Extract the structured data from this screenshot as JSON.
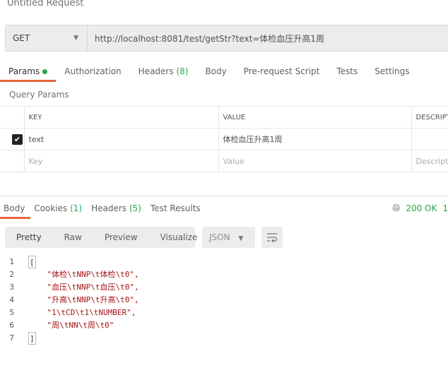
{
  "title": "Untitled Request",
  "request": {
    "method": "GET",
    "url": "http://localhost:8081/test/getStr?text=体检血压升高1周"
  },
  "tabs": [
    {
      "label": "Params"
    },
    {
      "label": "Authorization"
    },
    {
      "label": "Headers",
      "count": "(8)"
    },
    {
      "label": "Body"
    },
    {
      "label": "Pre-request Script"
    },
    {
      "label": "Tests"
    },
    {
      "label": "Settings"
    }
  ],
  "query_params_label": "Query Params",
  "params_table": {
    "headers": [
      "KEY",
      "VALUE",
      "DESCRIPT"
    ],
    "rows": [
      {
        "checked": true,
        "key": "text",
        "value": "体检血压升高1周"
      }
    ],
    "placeholder": {
      "key": "Key",
      "value": "Value",
      "desc": "Descript"
    }
  },
  "response": {
    "tabs": [
      {
        "label": "Body"
      },
      {
        "label": "Cookies",
        "count": "(1)"
      },
      {
        "label": "Headers",
        "count": "(5)"
      },
      {
        "label": "Test Results"
      }
    ],
    "status": "200 OK",
    "extra": "1",
    "views": [
      "Pretty",
      "Raw",
      "Preview",
      "Visualize"
    ],
    "format": "JSON",
    "lines": [
      "[",
      "    \"体检\\tNNP\\t体检\\t0\",",
      "    \"血压\\tNNP\\t血压\\t0\",",
      "    \"升高\\tNNP\\t升高\\t0\",",
      "    \"1\\tCD\\t1\\tNUMBER\",",
      "    \"周\\tNN\\t周\\t0\"",
      "]"
    ]
  },
  "colors": {
    "accent": "#e8663d",
    "green": "#2ba24c",
    "string": "#a31515"
  }
}
